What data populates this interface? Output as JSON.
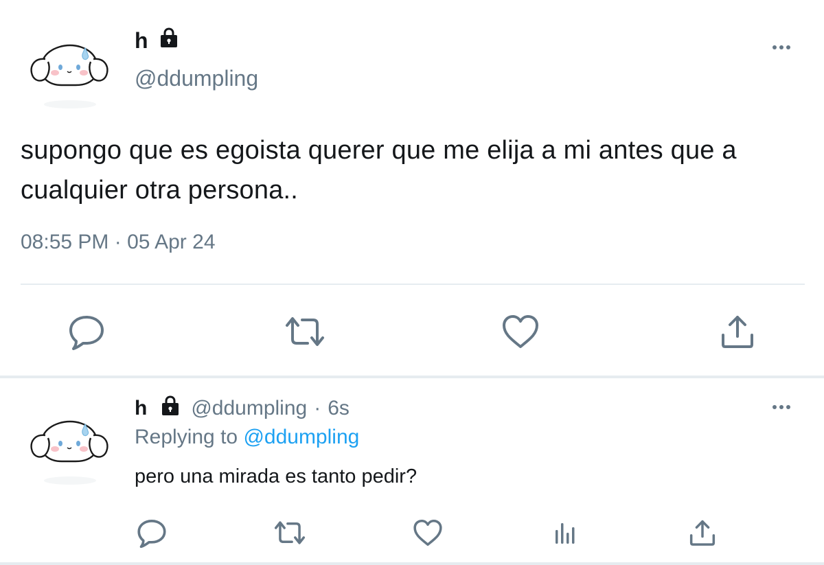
{
  "main_tweet": {
    "display_name": "h",
    "handle": "@ddumpling",
    "text": "supongo que es egoista querer que me elija a mi antes que a cualquier otra persona..",
    "timestamp": "08:55 PM · 05 Apr 24",
    "actions": [
      "reply-icon",
      "retweet-icon",
      "like-icon",
      "share-icon"
    ]
  },
  "reply_tweet": {
    "display_name": "h",
    "handle": "@ddumpling",
    "separator": "·",
    "age": "6s",
    "replying_prefix": "Replying to",
    "replying_handle": "@ddumpling",
    "text": "pero una mirada es tanto pedir?",
    "actions": [
      "reply-icon",
      "retweet-icon",
      "like-icon",
      "analytics-icon",
      "share-icon"
    ]
  },
  "colors": {
    "text": "#14171a",
    "secondary": "#657786",
    "link": "#1da1f2",
    "divider": "#e6ecf0"
  }
}
